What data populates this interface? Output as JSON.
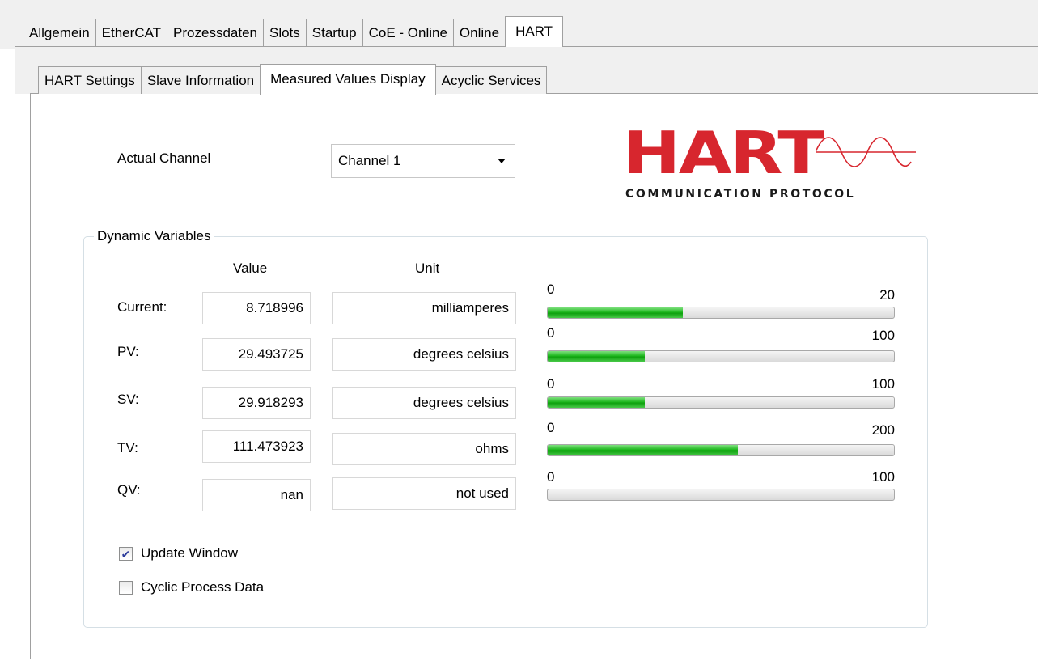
{
  "tabs": [
    "Allgemein",
    "EtherCAT",
    "Prozessdaten",
    "Slots",
    "Startup",
    "CoE - Online",
    "Online",
    "HART"
  ],
  "active_tab": "HART",
  "subtabs": [
    "HART Settings",
    "Slave Information",
    "Measured Values Display",
    "Acyclic Services"
  ],
  "active_subtab": "Measured Values Display",
  "channel": {
    "label": "Actual Channel",
    "selected": "Channel 1"
  },
  "logo": {
    "wordmark": "HART",
    "tagline": "COMMUNICATION PROTOCOL",
    "color": "#d7262e"
  },
  "dynamic": {
    "title": "Dynamic Variables",
    "col_value": "Value",
    "col_unit": "Unit",
    "rows": [
      {
        "label": "Current:",
        "value": "8.718996",
        "unit": "milliamperes",
        "min": "0",
        "max": "20",
        "fraction": 0.39
      },
      {
        "label": "PV:",
        "value": "29.493725",
        "unit": "degrees celsius",
        "min": "0",
        "max": "100",
        "fraction": 0.28
      },
      {
        "label": "SV:",
        "value": "29.918293",
        "unit": "degrees celsius",
        "min": "0",
        "max": "100",
        "fraction": 0.28
      },
      {
        "label": "TV:",
        "value": "111.473923",
        "unit": "ohms",
        "min": "0",
        "max": "200",
        "fraction": 0.55
      },
      {
        "label": "QV:",
        "value": "nan",
        "unit": "not used",
        "min": "0",
        "max": "100",
        "fraction": 0.0
      }
    ]
  },
  "options": {
    "update_window": {
      "label": "Update Window",
      "checked": true
    },
    "cyclic_process": {
      "label": "Cyclic Process Data",
      "checked": false
    }
  }
}
